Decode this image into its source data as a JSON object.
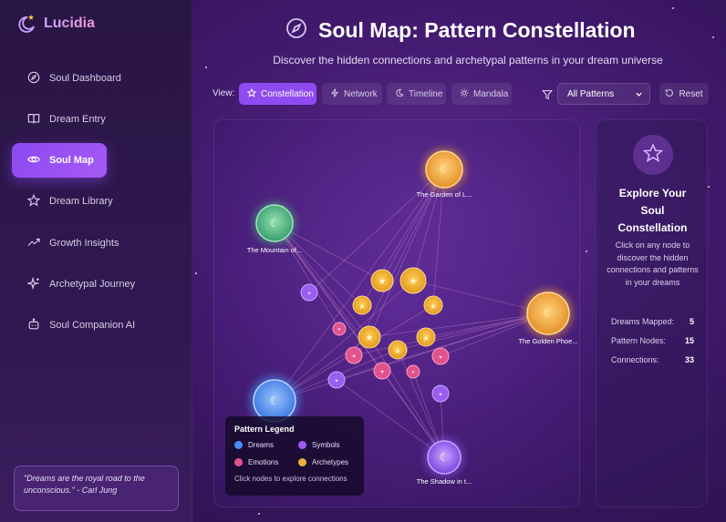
{
  "brand": {
    "name": "Lucidia"
  },
  "sidebar": {
    "items": [
      {
        "label": "Soul Dashboard",
        "icon": "compass-icon"
      },
      {
        "label": "Dream Entry",
        "icon": "book-icon"
      },
      {
        "label": "Soul Map",
        "icon": "eye-icon",
        "active": true
      },
      {
        "label": "Dream Library",
        "icon": "star-icon"
      },
      {
        "label": "Growth Insights",
        "icon": "trending-up-icon"
      },
      {
        "label": "Archetypal Journey",
        "icon": "sparkles-icon"
      },
      {
        "label": "Soul Companion AI",
        "icon": "bot-icon"
      }
    ],
    "quote": "\"Dreams are the royal road to the unconscious.\" - Carl Jung"
  },
  "header": {
    "title": "Soul Map: Pattern Constellation",
    "subtitle": "Discover the hidden connections and archetypal patterns in your dream universe"
  },
  "toolbar": {
    "view_label": "View:",
    "views": [
      {
        "label": "Constellation",
        "icon": "star-icon",
        "active": true
      },
      {
        "label": "Network",
        "icon": "zap-icon"
      },
      {
        "label": "Timeline",
        "icon": "moon-icon"
      },
      {
        "label": "Mandala",
        "icon": "sun-icon"
      }
    ],
    "filter_selected": "All Patterns",
    "reset_label": "Reset"
  },
  "constellation": {
    "dream_nodes": [
      {
        "label": "The Garden of L...",
        "color": "#f0a63a"
      },
      {
        "label": "The Mountain of...",
        "color": "#4fbf86"
      },
      {
        "label": "The Golden Phoe...",
        "color": "#f0a63a"
      },
      {
        "label": "The Shadow in t...",
        "color": "#8d5cf0"
      },
      {
        "label": "",
        "color": "#4a8cf0"
      }
    ]
  },
  "legend": {
    "title": "Pattern Legend",
    "items": [
      {
        "label": "Dreams",
        "color": "#4a8cf0"
      },
      {
        "label": "Symbols",
        "color": "#a05cf0"
      },
      {
        "label": "Emotions",
        "color": "#e0548e"
      },
      {
        "label": "Archetypes",
        "color": "#e8b03a"
      }
    ],
    "hint": "Click nodes to explore connections"
  },
  "info": {
    "title": "Explore Your Soul Constellation",
    "description": "Click on any node to discover the hidden connections and patterns in your dreams",
    "stats": [
      {
        "label": "Dreams Mapped:",
        "value": "5"
      },
      {
        "label": "Pattern Nodes:",
        "value": "15"
      },
      {
        "label": "Connections:",
        "value": "33"
      }
    ]
  }
}
